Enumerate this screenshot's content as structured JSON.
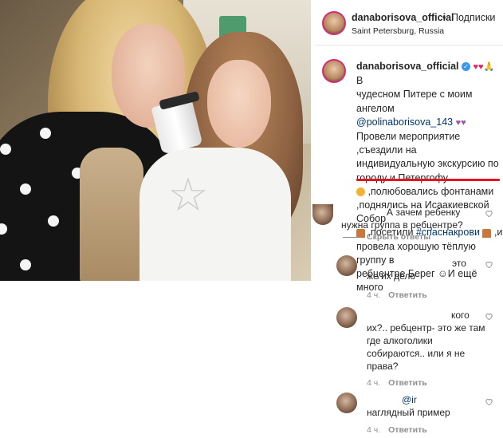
{
  "post": {
    "username": "danaborisova_official",
    "separator": "•",
    "follow_label": "Подписки",
    "location": "Saint Petersburg, Russia"
  },
  "caption": {
    "username": "danaborisova_official",
    "emoji_line1": "♥♥🙏",
    "line1_after": "В",
    "line2": "чудесном Питере с моим ангелом",
    "mention": "@polinaborisova_143",
    "mention_emojis": "♥♥",
    "line4": "Провели мероприятие ,съездили на",
    "line5": "индивидуальную экскурсию по",
    "line6": "городу и Петергофу",
    "line7": ",полюбовались фонтанами",
    "line8": ",поднялись на Исаакиевской Собор",
    "line9_pre": ",посетили",
    "hashtag": "#спаснакрови",
    "line9_post": ",и",
    "line10": "провела хорошую тёплую группу в",
    "line11": "ребцентре Берег",
    "line11_post": "☺И ещё много"
  },
  "comments": [
    {
      "text_l1": "А зачем ребенку",
      "text_l2": "нужна группа в ребцентре?"
    },
    {
      "hide_replies": "Скрыть ответы"
    },
    {
      "text_l1": "это",
      "text_l2": "же их дело",
      "age": "4 ч.",
      "reply": "Ответить"
    },
    {
      "text_l1": "кого",
      "text_l2": "их?.. ребцентр- это же там",
      "text_l3": "где алкоголики",
      "text_l4": "собираются.. или я не",
      "text_l5": "права?",
      "age": "4 ч.",
      "reply": "Ответить"
    },
    {
      "mention": "@ir",
      "text_l2": "наглядный пример",
      "age": "4 ч.",
      "reply": "Ответить"
    }
  ],
  "colors": {
    "underline": "#e8131f",
    "link": "#00376b",
    "meta": "#8e8e8e"
  }
}
